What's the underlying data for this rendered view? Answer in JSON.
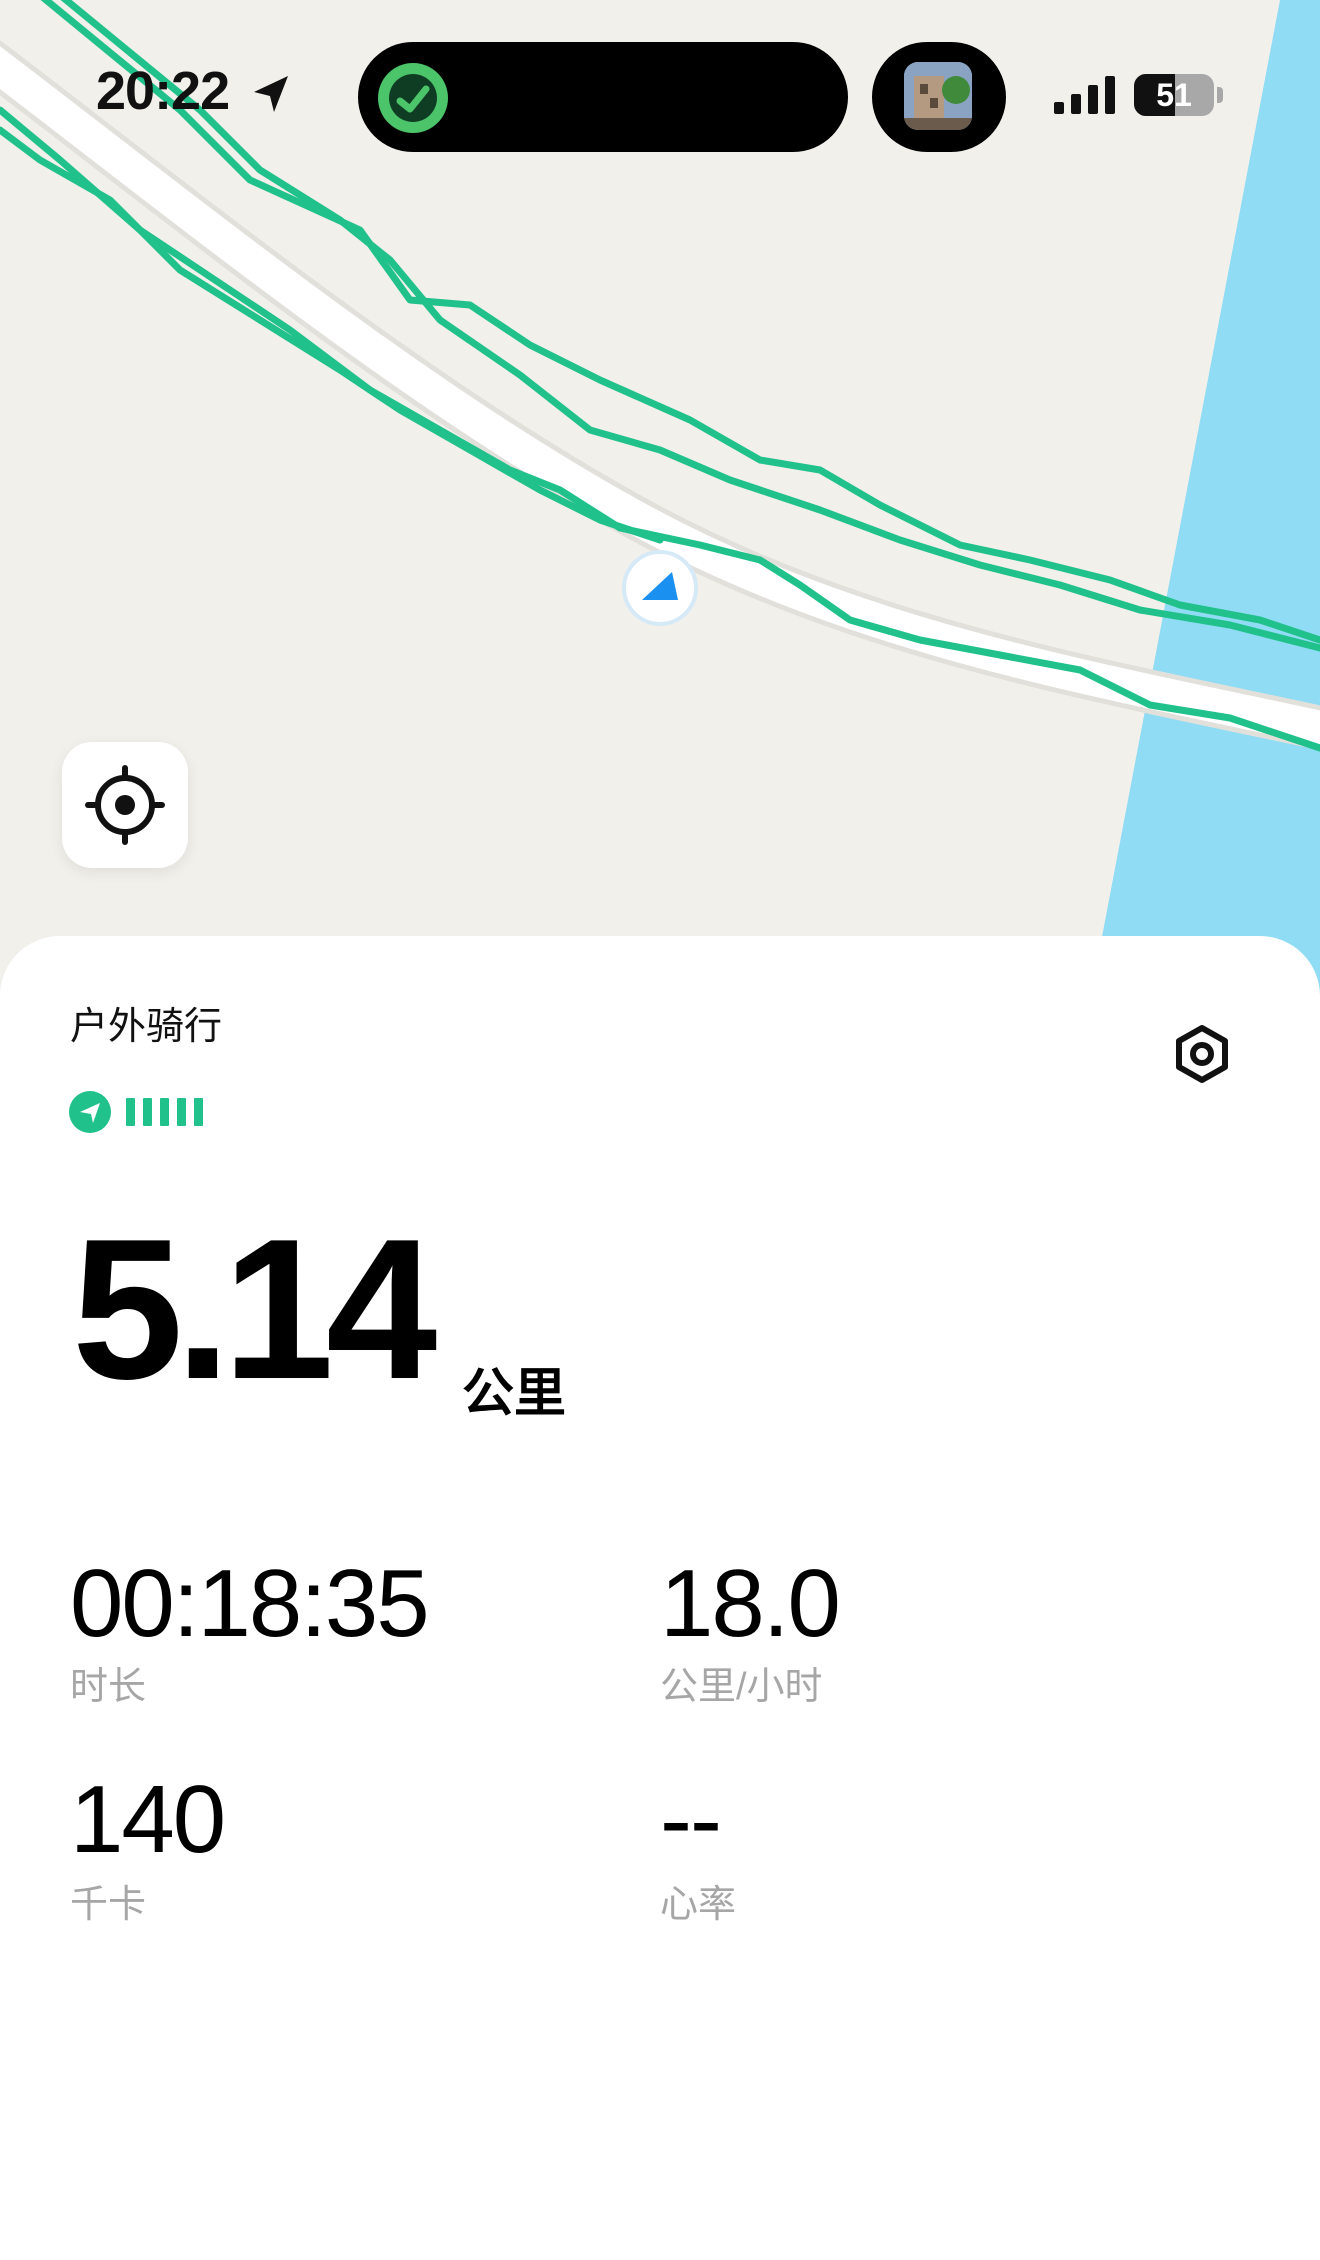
{
  "status_bar": {
    "time": "20:22",
    "battery_level": "51",
    "battery_fraction": 0.51,
    "location_icon": "location-arrow-icon",
    "signal_icon": "cellular-signal-icon"
  },
  "map": {
    "land_color": "#f2f0eb",
    "water_color": "#8fdcf4",
    "route_color": "#21c18c",
    "road_color": "#ffffff",
    "current_position_icon": "navigation-arrow-icon",
    "locate_icon": "crosshair-target-icon"
  },
  "activity": {
    "title": "户外骑行",
    "gps_icon": "gps-signal-icon",
    "settings_icon": "settings-hexagon-icon"
  },
  "distance": {
    "value": "5.14",
    "unit": "公里"
  },
  "stats": [
    {
      "value": "00:18:35",
      "label": "时长"
    },
    {
      "value": "18.0",
      "label": "公里/小时"
    },
    {
      "value": "140",
      "label": "千卡"
    },
    {
      "value": "--",
      "label": "心率"
    }
  ],
  "colors": {
    "accent": "#21c18c",
    "label_gray": "#a6a6a6"
  }
}
